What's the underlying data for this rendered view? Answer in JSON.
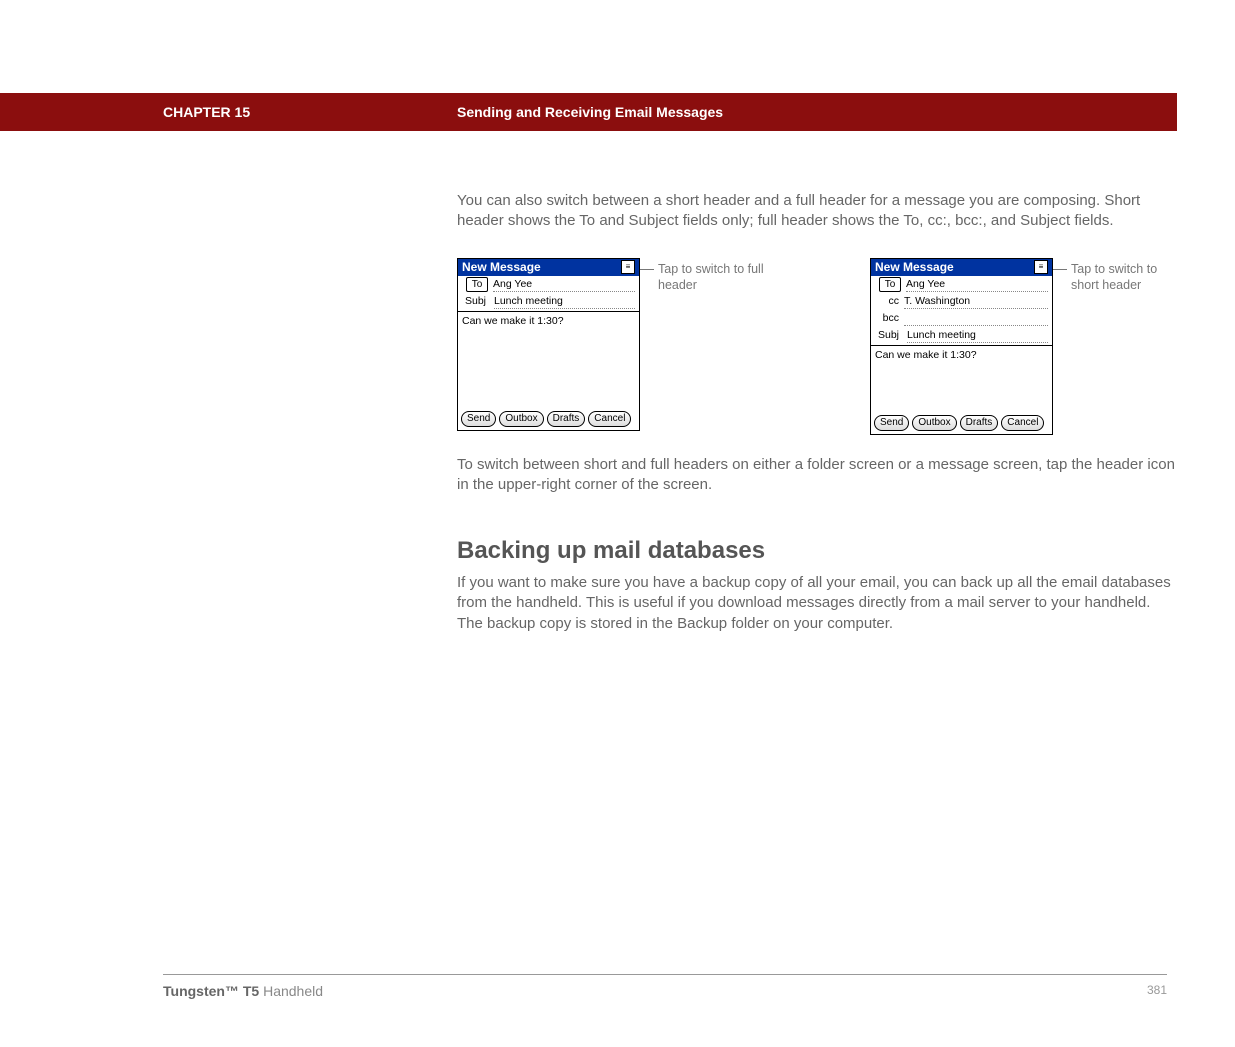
{
  "header": {
    "chapter": "CHAPTER 15",
    "title": "Sending and Receiving Email Messages"
  },
  "intro": "You can also switch between a short header and a full header for a message you are composing. Short header shows the To and Subject fields only; full header shows the To, cc:, bcc:, and Subject fields.",
  "callout_left": "Tap to switch to full header",
  "callout_right": "Tap to switch to short header",
  "palm": {
    "title": "New Message",
    "to_label": "To",
    "cc_label": "cc",
    "bcc_label": "bcc",
    "subj_label": "Subj",
    "to_value": "Ang Yee",
    "cc_value": "T. Washington",
    "bcc_value": "",
    "subj_value": "Lunch meeting",
    "body": "Can we make it 1:30?",
    "buttons": {
      "send": "Send",
      "outbox": "Outbox",
      "drafts": "Drafts",
      "cancel": "Cancel"
    }
  },
  "after_screens": "To switch between short and full headers on either a folder screen or a message screen, tap the header icon in the upper-right corner of the screen.",
  "section_heading": "Backing up mail databases",
  "section_body": "If you want to make sure you have a backup copy of all your email, you can back up all the email databases from the handheld. This is useful if you download messages directly from a mail server to your handheld. The backup copy is stored in the Backup folder on your computer.",
  "footer": {
    "product_bold": "Tungsten™ T5",
    "product_tail": " Handheld",
    "page": "381"
  }
}
